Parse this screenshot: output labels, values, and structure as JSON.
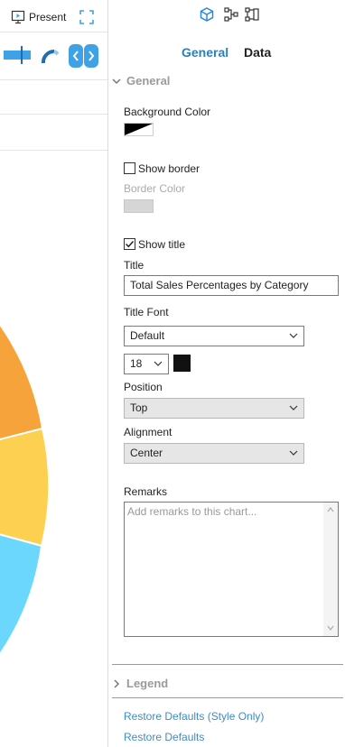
{
  "left_toolbar": {
    "present_label": "Present",
    "present_icon": "present-icon",
    "fullscreen_icon": "fullscreen-icon"
  },
  "chart_preview": {
    "colors": [
      "#f5a33a",
      "#fdd052",
      "#6cd7fd"
    ]
  },
  "panel": {
    "top_icons": [
      "cube-icon",
      "fields-icon",
      "layout-icon"
    ],
    "tabs": [
      {
        "label": "General",
        "active": true
      },
      {
        "label": "Data",
        "active": false
      }
    ],
    "general": {
      "section_title": "General",
      "background_color_label": "Background Color",
      "show_border_label": "Show border",
      "show_border_checked": false,
      "border_color_label": "Border Color",
      "show_title_label": "Show title",
      "show_title_checked": true,
      "title_label": "Title",
      "title_value": "Total Sales Percentages by Category",
      "title_font_label": "Title Font",
      "title_font_value": "Default",
      "font_size_value": "18",
      "font_color": "#111111",
      "position_label": "Position",
      "position_value": "Top",
      "alignment_label": "Alignment",
      "alignment_value": "Center",
      "remarks_label": "Remarks",
      "remarks_placeholder": "Add remarks to this chart..."
    },
    "legend": {
      "section_title": "Legend"
    },
    "restore_style_label": "Restore Defaults (Style Only)",
    "restore_label": "Restore Defaults"
  },
  "colors": {
    "accent": "#2a7fc0",
    "link": "#3c8dc8",
    "nav_button": "#3fa2e6"
  }
}
